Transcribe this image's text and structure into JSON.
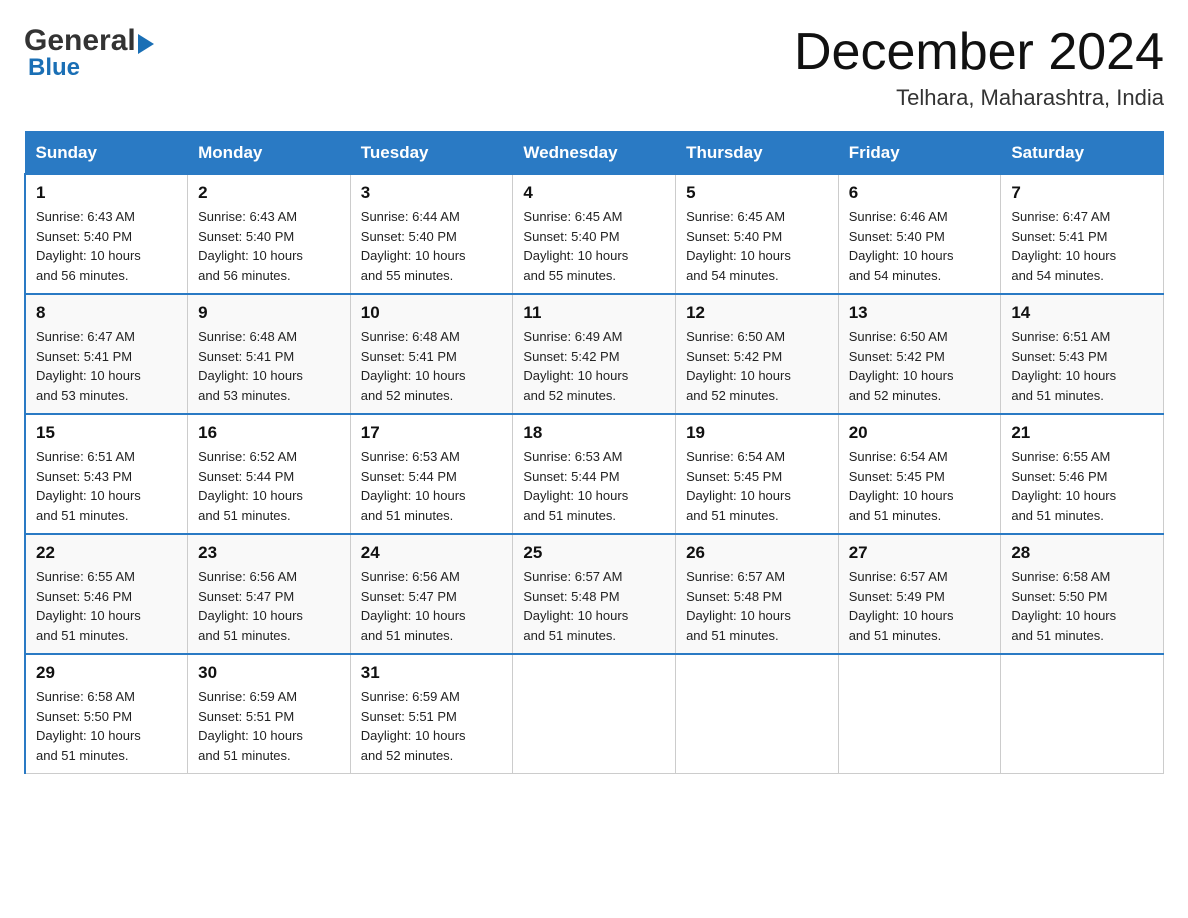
{
  "header": {
    "logo": {
      "general": "General",
      "arrow": "▶",
      "blue": "Blue"
    },
    "title": "December 2024",
    "location": "Telhara, Maharashtra, India"
  },
  "weekdays": [
    "Sunday",
    "Monday",
    "Tuesday",
    "Wednesday",
    "Thursday",
    "Friday",
    "Saturday"
  ],
  "weeks": [
    [
      {
        "day": "1",
        "info": "Sunrise: 6:43 AM\nSunset: 5:40 PM\nDaylight: 10 hours\nand 56 minutes."
      },
      {
        "day": "2",
        "info": "Sunrise: 6:43 AM\nSunset: 5:40 PM\nDaylight: 10 hours\nand 56 minutes."
      },
      {
        "day": "3",
        "info": "Sunrise: 6:44 AM\nSunset: 5:40 PM\nDaylight: 10 hours\nand 55 minutes."
      },
      {
        "day": "4",
        "info": "Sunrise: 6:45 AM\nSunset: 5:40 PM\nDaylight: 10 hours\nand 55 minutes."
      },
      {
        "day": "5",
        "info": "Sunrise: 6:45 AM\nSunset: 5:40 PM\nDaylight: 10 hours\nand 54 minutes."
      },
      {
        "day": "6",
        "info": "Sunrise: 6:46 AM\nSunset: 5:40 PM\nDaylight: 10 hours\nand 54 minutes."
      },
      {
        "day": "7",
        "info": "Sunrise: 6:47 AM\nSunset: 5:41 PM\nDaylight: 10 hours\nand 54 minutes."
      }
    ],
    [
      {
        "day": "8",
        "info": "Sunrise: 6:47 AM\nSunset: 5:41 PM\nDaylight: 10 hours\nand 53 minutes."
      },
      {
        "day": "9",
        "info": "Sunrise: 6:48 AM\nSunset: 5:41 PM\nDaylight: 10 hours\nand 53 minutes."
      },
      {
        "day": "10",
        "info": "Sunrise: 6:48 AM\nSunset: 5:41 PM\nDaylight: 10 hours\nand 52 minutes."
      },
      {
        "day": "11",
        "info": "Sunrise: 6:49 AM\nSunset: 5:42 PM\nDaylight: 10 hours\nand 52 minutes."
      },
      {
        "day": "12",
        "info": "Sunrise: 6:50 AM\nSunset: 5:42 PM\nDaylight: 10 hours\nand 52 minutes."
      },
      {
        "day": "13",
        "info": "Sunrise: 6:50 AM\nSunset: 5:42 PM\nDaylight: 10 hours\nand 52 minutes."
      },
      {
        "day": "14",
        "info": "Sunrise: 6:51 AM\nSunset: 5:43 PM\nDaylight: 10 hours\nand 51 minutes."
      }
    ],
    [
      {
        "day": "15",
        "info": "Sunrise: 6:51 AM\nSunset: 5:43 PM\nDaylight: 10 hours\nand 51 minutes."
      },
      {
        "day": "16",
        "info": "Sunrise: 6:52 AM\nSunset: 5:44 PM\nDaylight: 10 hours\nand 51 minutes."
      },
      {
        "day": "17",
        "info": "Sunrise: 6:53 AM\nSunset: 5:44 PM\nDaylight: 10 hours\nand 51 minutes."
      },
      {
        "day": "18",
        "info": "Sunrise: 6:53 AM\nSunset: 5:44 PM\nDaylight: 10 hours\nand 51 minutes."
      },
      {
        "day": "19",
        "info": "Sunrise: 6:54 AM\nSunset: 5:45 PM\nDaylight: 10 hours\nand 51 minutes."
      },
      {
        "day": "20",
        "info": "Sunrise: 6:54 AM\nSunset: 5:45 PM\nDaylight: 10 hours\nand 51 minutes."
      },
      {
        "day": "21",
        "info": "Sunrise: 6:55 AM\nSunset: 5:46 PM\nDaylight: 10 hours\nand 51 minutes."
      }
    ],
    [
      {
        "day": "22",
        "info": "Sunrise: 6:55 AM\nSunset: 5:46 PM\nDaylight: 10 hours\nand 51 minutes."
      },
      {
        "day": "23",
        "info": "Sunrise: 6:56 AM\nSunset: 5:47 PM\nDaylight: 10 hours\nand 51 minutes."
      },
      {
        "day": "24",
        "info": "Sunrise: 6:56 AM\nSunset: 5:47 PM\nDaylight: 10 hours\nand 51 minutes."
      },
      {
        "day": "25",
        "info": "Sunrise: 6:57 AM\nSunset: 5:48 PM\nDaylight: 10 hours\nand 51 minutes."
      },
      {
        "day": "26",
        "info": "Sunrise: 6:57 AM\nSunset: 5:48 PM\nDaylight: 10 hours\nand 51 minutes."
      },
      {
        "day": "27",
        "info": "Sunrise: 6:57 AM\nSunset: 5:49 PM\nDaylight: 10 hours\nand 51 minutes."
      },
      {
        "day": "28",
        "info": "Sunrise: 6:58 AM\nSunset: 5:50 PM\nDaylight: 10 hours\nand 51 minutes."
      }
    ],
    [
      {
        "day": "29",
        "info": "Sunrise: 6:58 AM\nSunset: 5:50 PM\nDaylight: 10 hours\nand 51 minutes."
      },
      {
        "day": "30",
        "info": "Sunrise: 6:59 AM\nSunset: 5:51 PM\nDaylight: 10 hours\nand 51 minutes."
      },
      {
        "day": "31",
        "info": "Sunrise: 6:59 AM\nSunset: 5:51 PM\nDaylight: 10 hours\nand 52 minutes."
      },
      {
        "day": "",
        "info": ""
      },
      {
        "day": "",
        "info": ""
      },
      {
        "day": "",
        "info": ""
      },
      {
        "day": "",
        "info": ""
      }
    ]
  ]
}
